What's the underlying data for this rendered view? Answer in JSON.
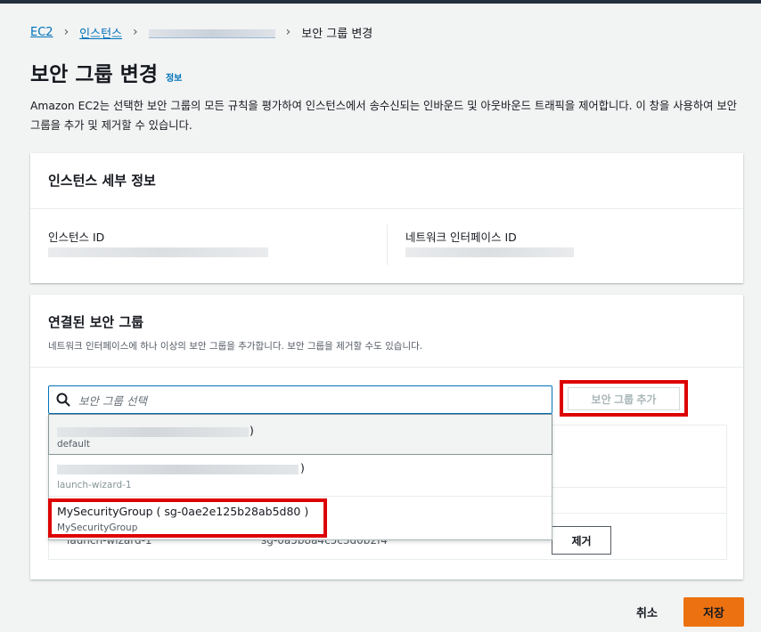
{
  "breadcrumb": {
    "ec2": "EC2",
    "instances": "인스턴스",
    "current": "보안 그룹 변경"
  },
  "page": {
    "title": "보안 그룹 변경",
    "info": "정보",
    "description": "Amazon EC2는 선택한 보안 그룹의 모든 규칙을 평가하여 인스턴스에서 송수신되는 인바운드 및 아웃바운드 트래픽을 제어합니다. 이 창을 사용하여 보안 그룹을 추가 및 제거할 수 있습니다."
  },
  "instance_details": {
    "title": "인스턴스 세부 정보",
    "instance_id_label": "인스턴스 ID",
    "network_interface_id_label": "네트워크 인터페이스 ID"
  },
  "security_groups": {
    "title": "연결된 보안 그룹",
    "subtitle": "네트워크 인터페이스에 하나 이상의 보안 그룹을 추가합니다. 보안 그룹을 제거할 수도 있습니다.",
    "search_placeholder": "보안 그룹 선택",
    "add_button": "보안 그룹 추가",
    "remove_button": "제거",
    "dropdown": [
      {
        "main_suffix": ")",
        "sub": "default"
      },
      {
        "main_suffix": ")",
        "sub": "launch-wizard-1"
      },
      {
        "main": "MySecurityGroup ( sg-0ae2e125b28ab5d80 )",
        "sub": "MySecurityGroup"
      }
    ],
    "row_under_name": "launch-wizard-1",
    "row_under_id": "sg-0a5b8a4c5c3d0b2f4"
  },
  "footer": {
    "cancel": "취소",
    "save": "저장"
  },
  "colors": {
    "link": "#0073bb",
    "primary": "#ec7211",
    "highlight": "#dd0000"
  }
}
